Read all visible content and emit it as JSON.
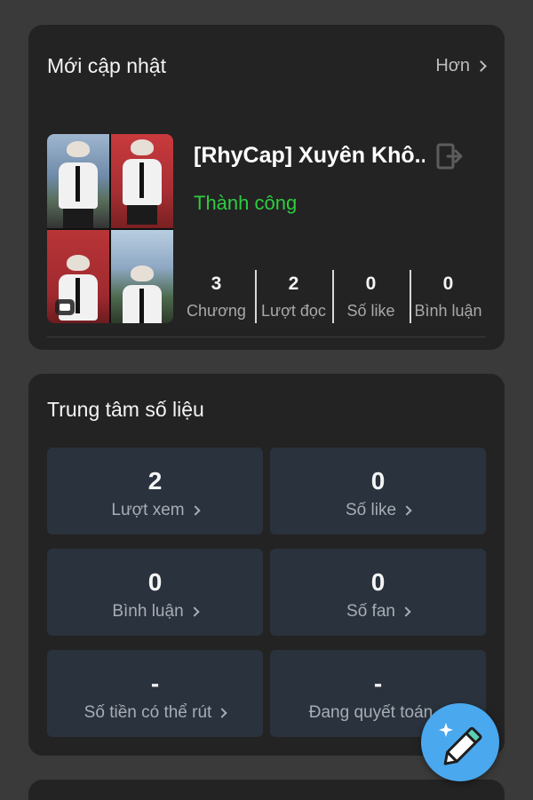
{
  "recent": {
    "title": "Mới cập nhật",
    "more_label": "Hơn",
    "book": {
      "title": "[RhyCap] Xuyên Khô...",
      "status": "Thành công",
      "metrics": [
        {
          "value": "3",
          "label": "Chương"
        },
        {
          "value": "2",
          "label": "Lượt đọc"
        },
        {
          "value": "0",
          "label": "Số like"
        },
        {
          "value": "0",
          "label": "Bình luận"
        }
      ]
    }
  },
  "stats": {
    "title": "Trung tâm số liệu",
    "tiles": [
      {
        "value": "2",
        "label": "Lượt xem"
      },
      {
        "value": "0",
        "label": "Số like"
      },
      {
        "value": "0",
        "label": "Bình luận"
      },
      {
        "value": "0",
        "label": "Số fan"
      },
      {
        "value": "-",
        "label": "Số tiền có thể rút"
      },
      {
        "value": "-",
        "label": "Đang quyết toán"
      }
    ]
  },
  "colors": {
    "background": "#3a3a3a",
    "card": "#232323",
    "tile": "#2a323d",
    "success": "#2ecc40",
    "fab": "#4aa8ee"
  },
  "icons": {
    "more": "chevron-right-icon",
    "exit": "exit-icon",
    "fab": "pencil-sparkle-icon",
    "cover_badge": "comment-icon"
  }
}
